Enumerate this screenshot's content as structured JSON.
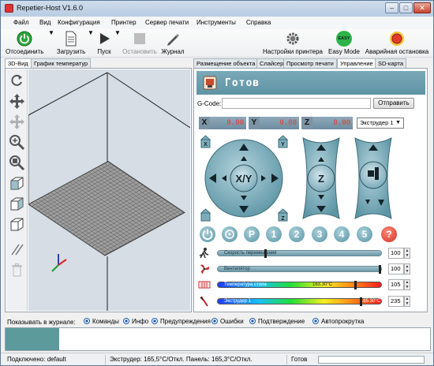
{
  "window": {
    "title": "Repetier-Host V1.6.0"
  },
  "menu": [
    "Файл",
    "Вид",
    "Конфигурация",
    "Принтер",
    "Сервер печати",
    "Инструменты",
    "Справка"
  ],
  "toolbar": {
    "disconnect": "Отсоединить",
    "load": "Загрузить",
    "run": "Пуск",
    "stop": "Остановить",
    "log": "Журнал",
    "printer_settings": "Настройки принтера",
    "easy_mode": "Easy Mode",
    "easy_badge": "EASY",
    "emergency_stop": "Аварийная остановка"
  },
  "left_tabs": [
    "3D-Вид",
    "График температур"
  ],
  "right_tabs": [
    "Размещение объекта",
    "Слайсер",
    "Просмотр печати",
    "Управление",
    "SD-карта"
  ],
  "control": {
    "status": "Готов",
    "gcode_label": "G-Code:",
    "gcode_value": "",
    "send_button": "Отправить",
    "x_label": "X",
    "x_value": "0.00",
    "y_label": "Y",
    "y_value": "0.00",
    "z_label": "Z",
    "z_value": "0.00",
    "extruder_select": "Экструдер 1",
    "xy_label": "X/Y",
    "z_pad_label": "Z",
    "home_badges": [
      "X",
      "Y",
      "Z"
    ],
    "number_buttons": [
      "1",
      "2",
      "3",
      "4",
      "5"
    ],
    "p_button": "P",
    "help_button": "?"
  },
  "sliders": [
    {
      "label": "Скорость перемещения",
      "value": "100",
      "level": 0.29
    },
    {
      "label": "Вентилятор",
      "value": "100",
      "level": 1.0
    },
    {
      "label": "Температура стола",
      "temp": "163.30°C",
      "value": "105",
      "level": 0.85
    },
    {
      "label": "Экструдер 1",
      "temp": "165.30°C",
      "value": "235",
      "level": 0.88
    }
  ],
  "log": {
    "label": "Показывать в журнале:",
    "options": [
      "Команды",
      "Инфо",
      "Предупреждения",
      "Ошибки",
      "Подтверждение",
      "Автопрокрутка"
    ]
  },
  "status_bar": {
    "connection": "Подключено: default",
    "temps": "Экструдер: 165,5°C/Откл. Панель: 165,3°C/Откл.",
    "state": "Готов"
  },
  "colors": {
    "accent": "#5e93a4",
    "coord_value": "#e43b2f",
    "emergency": "#e23b2a",
    "easy": "#2db34a"
  }
}
